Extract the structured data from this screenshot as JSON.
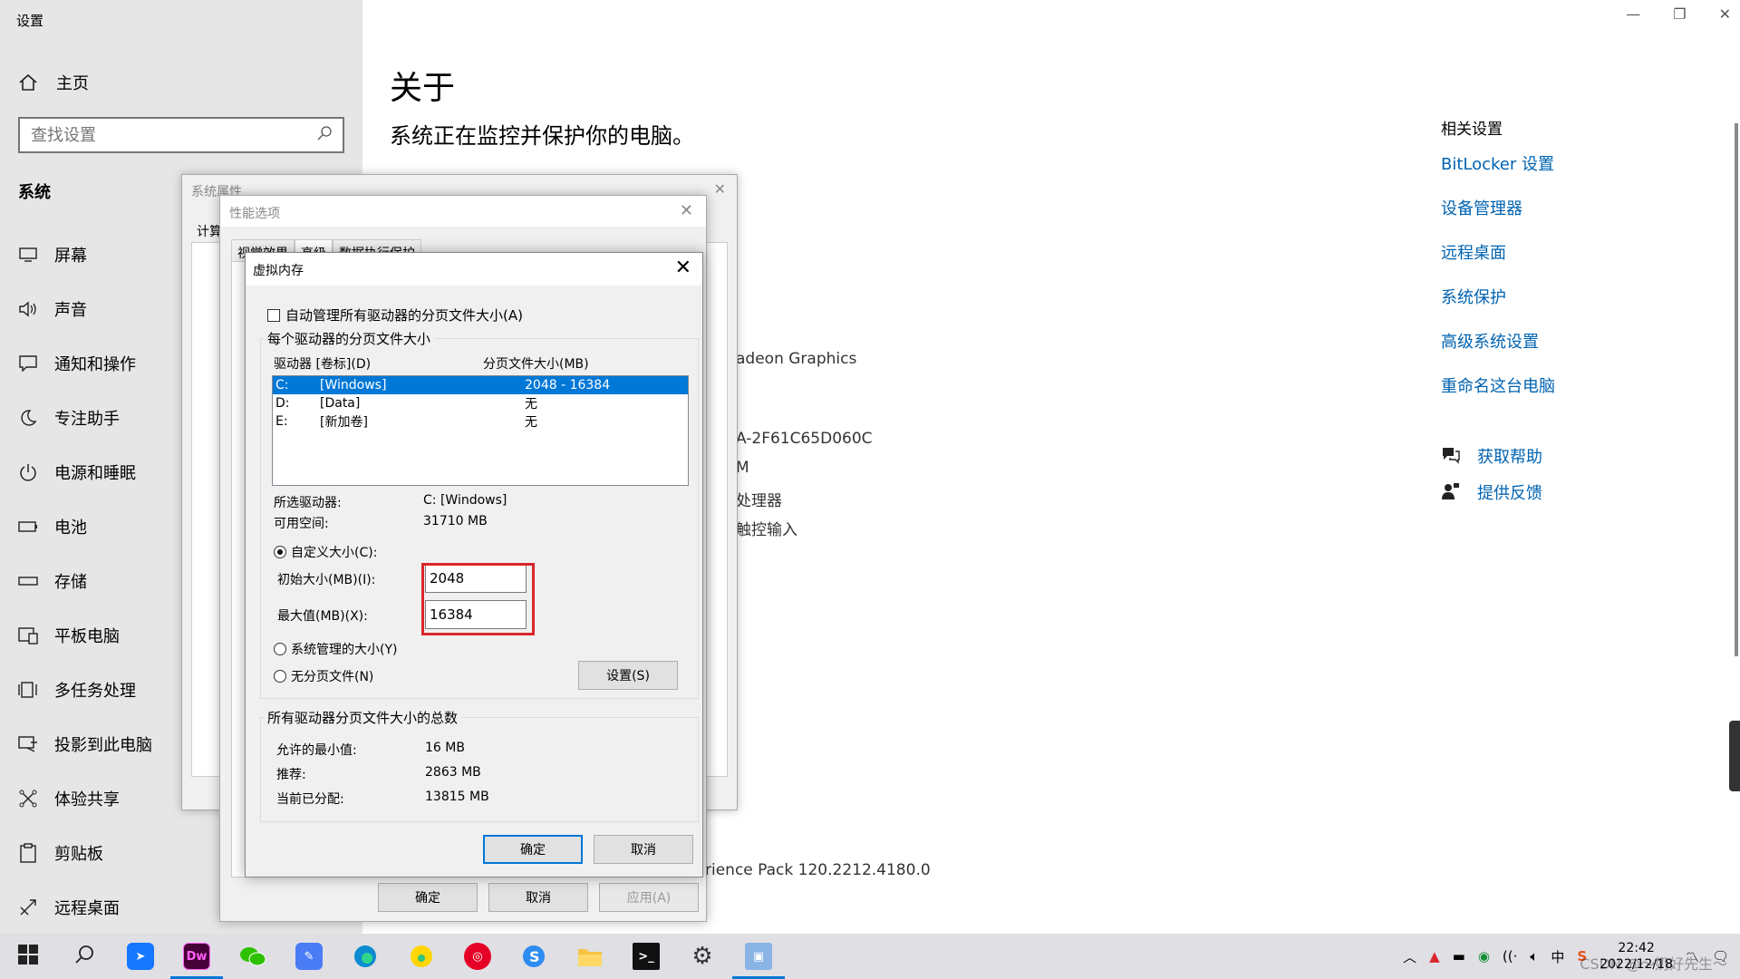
{
  "settings": {
    "app_title": "设置",
    "home_label": "主页",
    "search_placeholder": "查找设置",
    "section_title": "系统",
    "nav": [
      {
        "label": "屏幕",
        "icon": "monitor-icon"
      },
      {
        "label": "声音",
        "icon": "speaker-icon"
      },
      {
        "label": "通知和操作",
        "icon": "notification-icon"
      },
      {
        "label": "专注助手",
        "icon": "moon-icon"
      },
      {
        "label": "电源和睡眠",
        "icon": "power-icon"
      },
      {
        "label": "电池",
        "icon": "battery-icon"
      },
      {
        "label": "存储",
        "icon": "storage-icon"
      },
      {
        "label": "平板电脑",
        "icon": "tablet-icon"
      },
      {
        "label": "多任务处理",
        "icon": "multitask-icon"
      },
      {
        "label": "投影到此电脑",
        "icon": "project-icon"
      },
      {
        "label": "体验共享",
        "icon": "share-icon"
      },
      {
        "label": "剪贴板",
        "icon": "clipboard-icon"
      },
      {
        "label": "远程桌面",
        "icon": "remote-desktop-icon"
      }
    ]
  },
  "main": {
    "title": "关于",
    "subtitle": "系统正在监控并保护你的电脑。",
    "bg_fragments": {
      "gpu": "adeon Graphics",
      "id": "A-2F61C65D060C",
      "m": "M",
      "processor": "处理器",
      "touch": "触控输入",
      "experience": "rience Pack 120.2212.4180.0"
    }
  },
  "related": {
    "title": "相关设置",
    "links": [
      "BitLocker 设置",
      "设备管理器",
      "远程桌面",
      "系统保护",
      "高级系统设置",
      "重命名这台电脑"
    ],
    "help": "获取帮助",
    "feedback": "提供反馈"
  },
  "sysprop": {
    "title": "系统属性",
    "tab": "计算",
    "close": "✕"
  },
  "perfopt": {
    "title": "性能选项",
    "tabs": [
      "视觉效果",
      "高级",
      "数据执行保护"
    ],
    "ok": "确定",
    "cancel": "取消",
    "apply": "应用(A)",
    "close": "✕"
  },
  "vm": {
    "title": "虚拟内存",
    "close": "✕",
    "auto_manage": "自动管理所有驱动器的分页文件大小(A)",
    "group_title": "每个驱动器的分页文件大小",
    "col_drive": "驱动器 [卷标](D)",
    "col_size": "分页文件大小(MB)",
    "drives": [
      {
        "letter": "C:",
        "label": "[Windows]",
        "size": "2048 - 16384",
        "selected": true
      },
      {
        "letter": "D:",
        "label": "[Data]",
        "size": "无",
        "selected": false
      },
      {
        "letter": "E:",
        "label": "[新加卷]",
        "size": "无",
        "selected": false
      }
    ],
    "selected_drive_label": "所选驱动器:",
    "selected_drive_value": "C:  [Windows]",
    "free_space_label": "可用空间:",
    "free_space_value": "31710 MB",
    "custom_size": "自定义大小(C):",
    "initial_label": "初始大小(MB)(I):",
    "initial_value": "2048",
    "max_label": "最大值(MB)(X):",
    "max_value": "16384",
    "system_managed": "系统管理的大小(Y)",
    "no_paging": "无分页文件(N)",
    "set_button": "设置(S)",
    "total_group_title": "所有驱动器分页文件大小的总数",
    "min_allowed_label": "允许的最小值:",
    "min_allowed_value": "16 MB",
    "recommended_label": "推荐:",
    "recommended_value": "2863 MB",
    "allocated_label": "当前已分配:",
    "allocated_value": "13815 MB",
    "ok": "确定",
    "cancel": "取消"
  },
  "taskbar": {
    "apps": [
      "windows-start",
      "search",
      "app-blue-arrow",
      "dreamweaver",
      "wechat",
      "notes",
      "edge",
      "qq-music",
      "netease-music",
      "sogou",
      "file-explorer",
      "terminal",
      "settings",
      "remote-desktop-app"
    ],
    "dw_label": "Dw",
    "time": "22:42",
    "date": "2022/12/18",
    "ime": "中",
    "watermark": "CSDN @～奶好先生～"
  }
}
